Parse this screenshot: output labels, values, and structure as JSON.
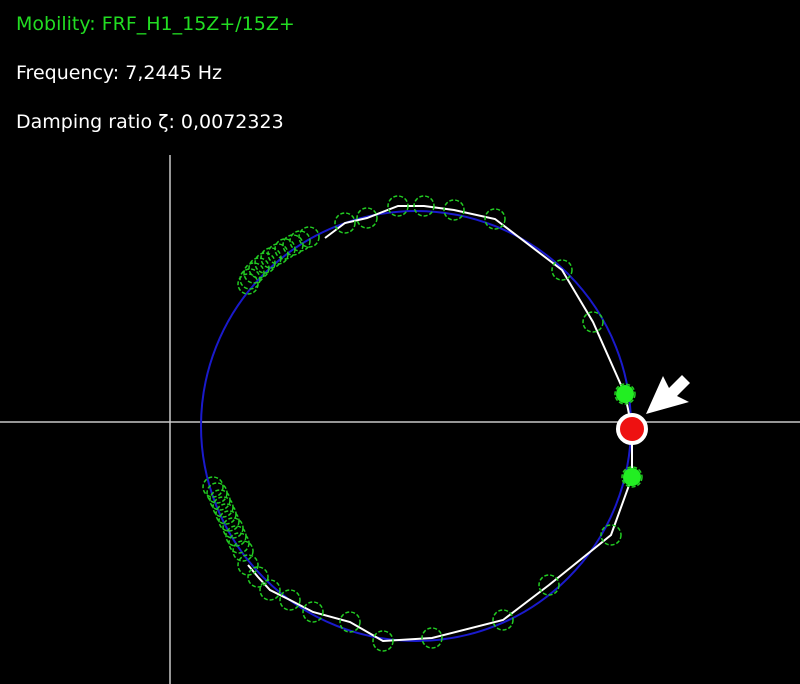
{
  "header": {
    "mobility_label": "Mobility:",
    "mobility_value": "FRF_H1_15Z+/15Z+",
    "frequency_label": "Frequency:",
    "frequency_value": "7,2445 Hz",
    "damping_label": "Damping ratio ζ:",
    "damping_value": "0,0072323"
  },
  "colors": {
    "background": "#000000",
    "mobility_text": "#22dd22",
    "text": "#ffffff",
    "axes": "#c8c8c8",
    "fitted_circle": "#1a1acc",
    "measured_path": "#ffffff",
    "measured_points": "#22cc22",
    "half_power_points": "#22ee22",
    "resonance_point": "#ee1111",
    "pointer_arrow": "#ffffff"
  },
  "icons": {
    "pointer": "arrow-pointer-icon"
  }
}
